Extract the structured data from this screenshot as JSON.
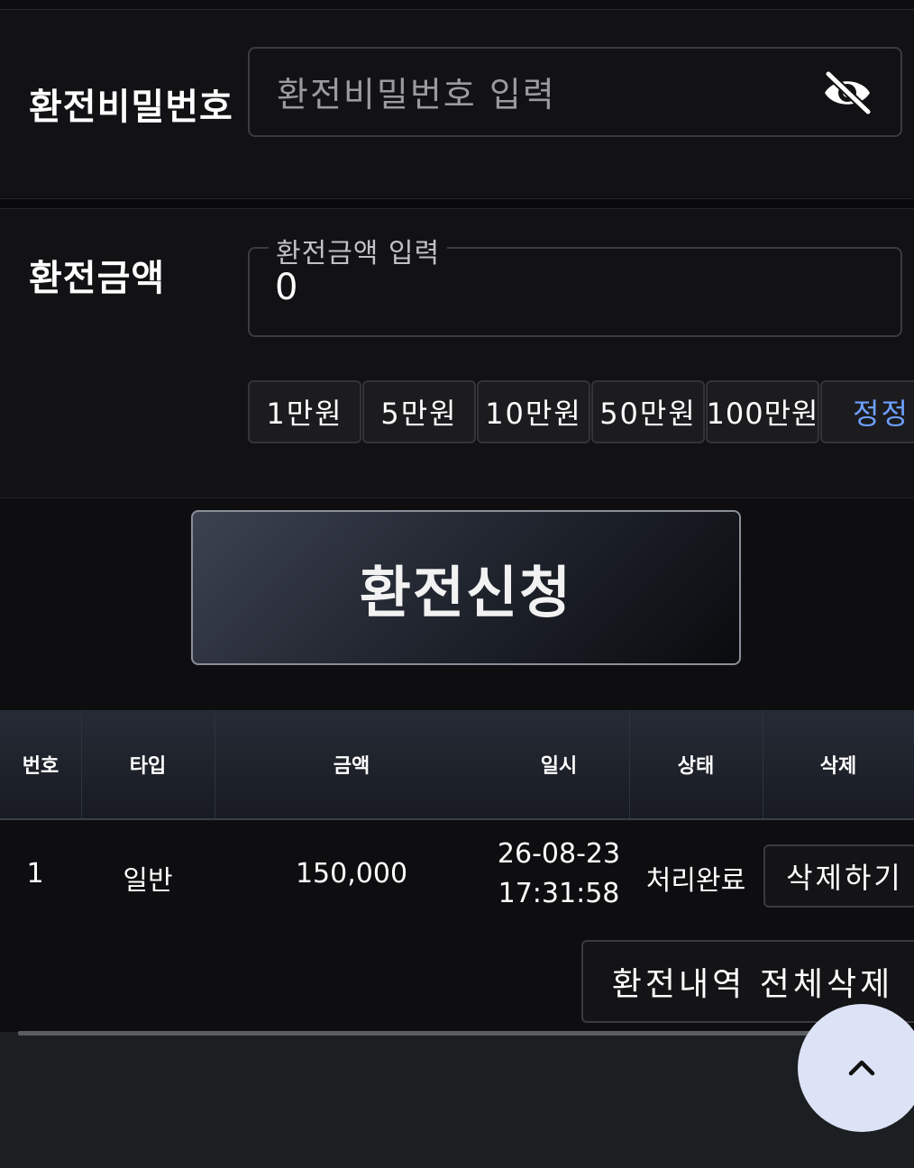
{
  "password": {
    "label": "환전비밀번호",
    "placeholder": "환전비밀번호 입력",
    "toggle_icon": "eye-off-icon"
  },
  "amount": {
    "label": "환전금액",
    "field_label": "환전금액 입력",
    "value": "0",
    "quick_buttons": [
      "1만원",
      "5만원",
      "10만원",
      "50만원",
      "100만원"
    ],
    "reset_label": "정정"
  },
  "submit_label": "환전신청",
  "table": {
    "headers": [
      "번호",
      "타입",
      "금액",
      "일시",
      "상태",
      "삭제"
    ],
    "rows": [
      {
        "no": "1",
        "type": "일반",
        "amount": "150,000",
        "date": "26-08-23",
        "time": "17:31:58",
        "status": "처리완료",
        "delete_label": "삭제하기"
      }
    ]
  },
  "delete_all_label": "환전내역 전체삭제",
  "scroll_top_icon": "chevron-up-icon",
  "colors": {
    "accent": "#6ea0ff",
    "fab": "#dde3f6"
  }
}
